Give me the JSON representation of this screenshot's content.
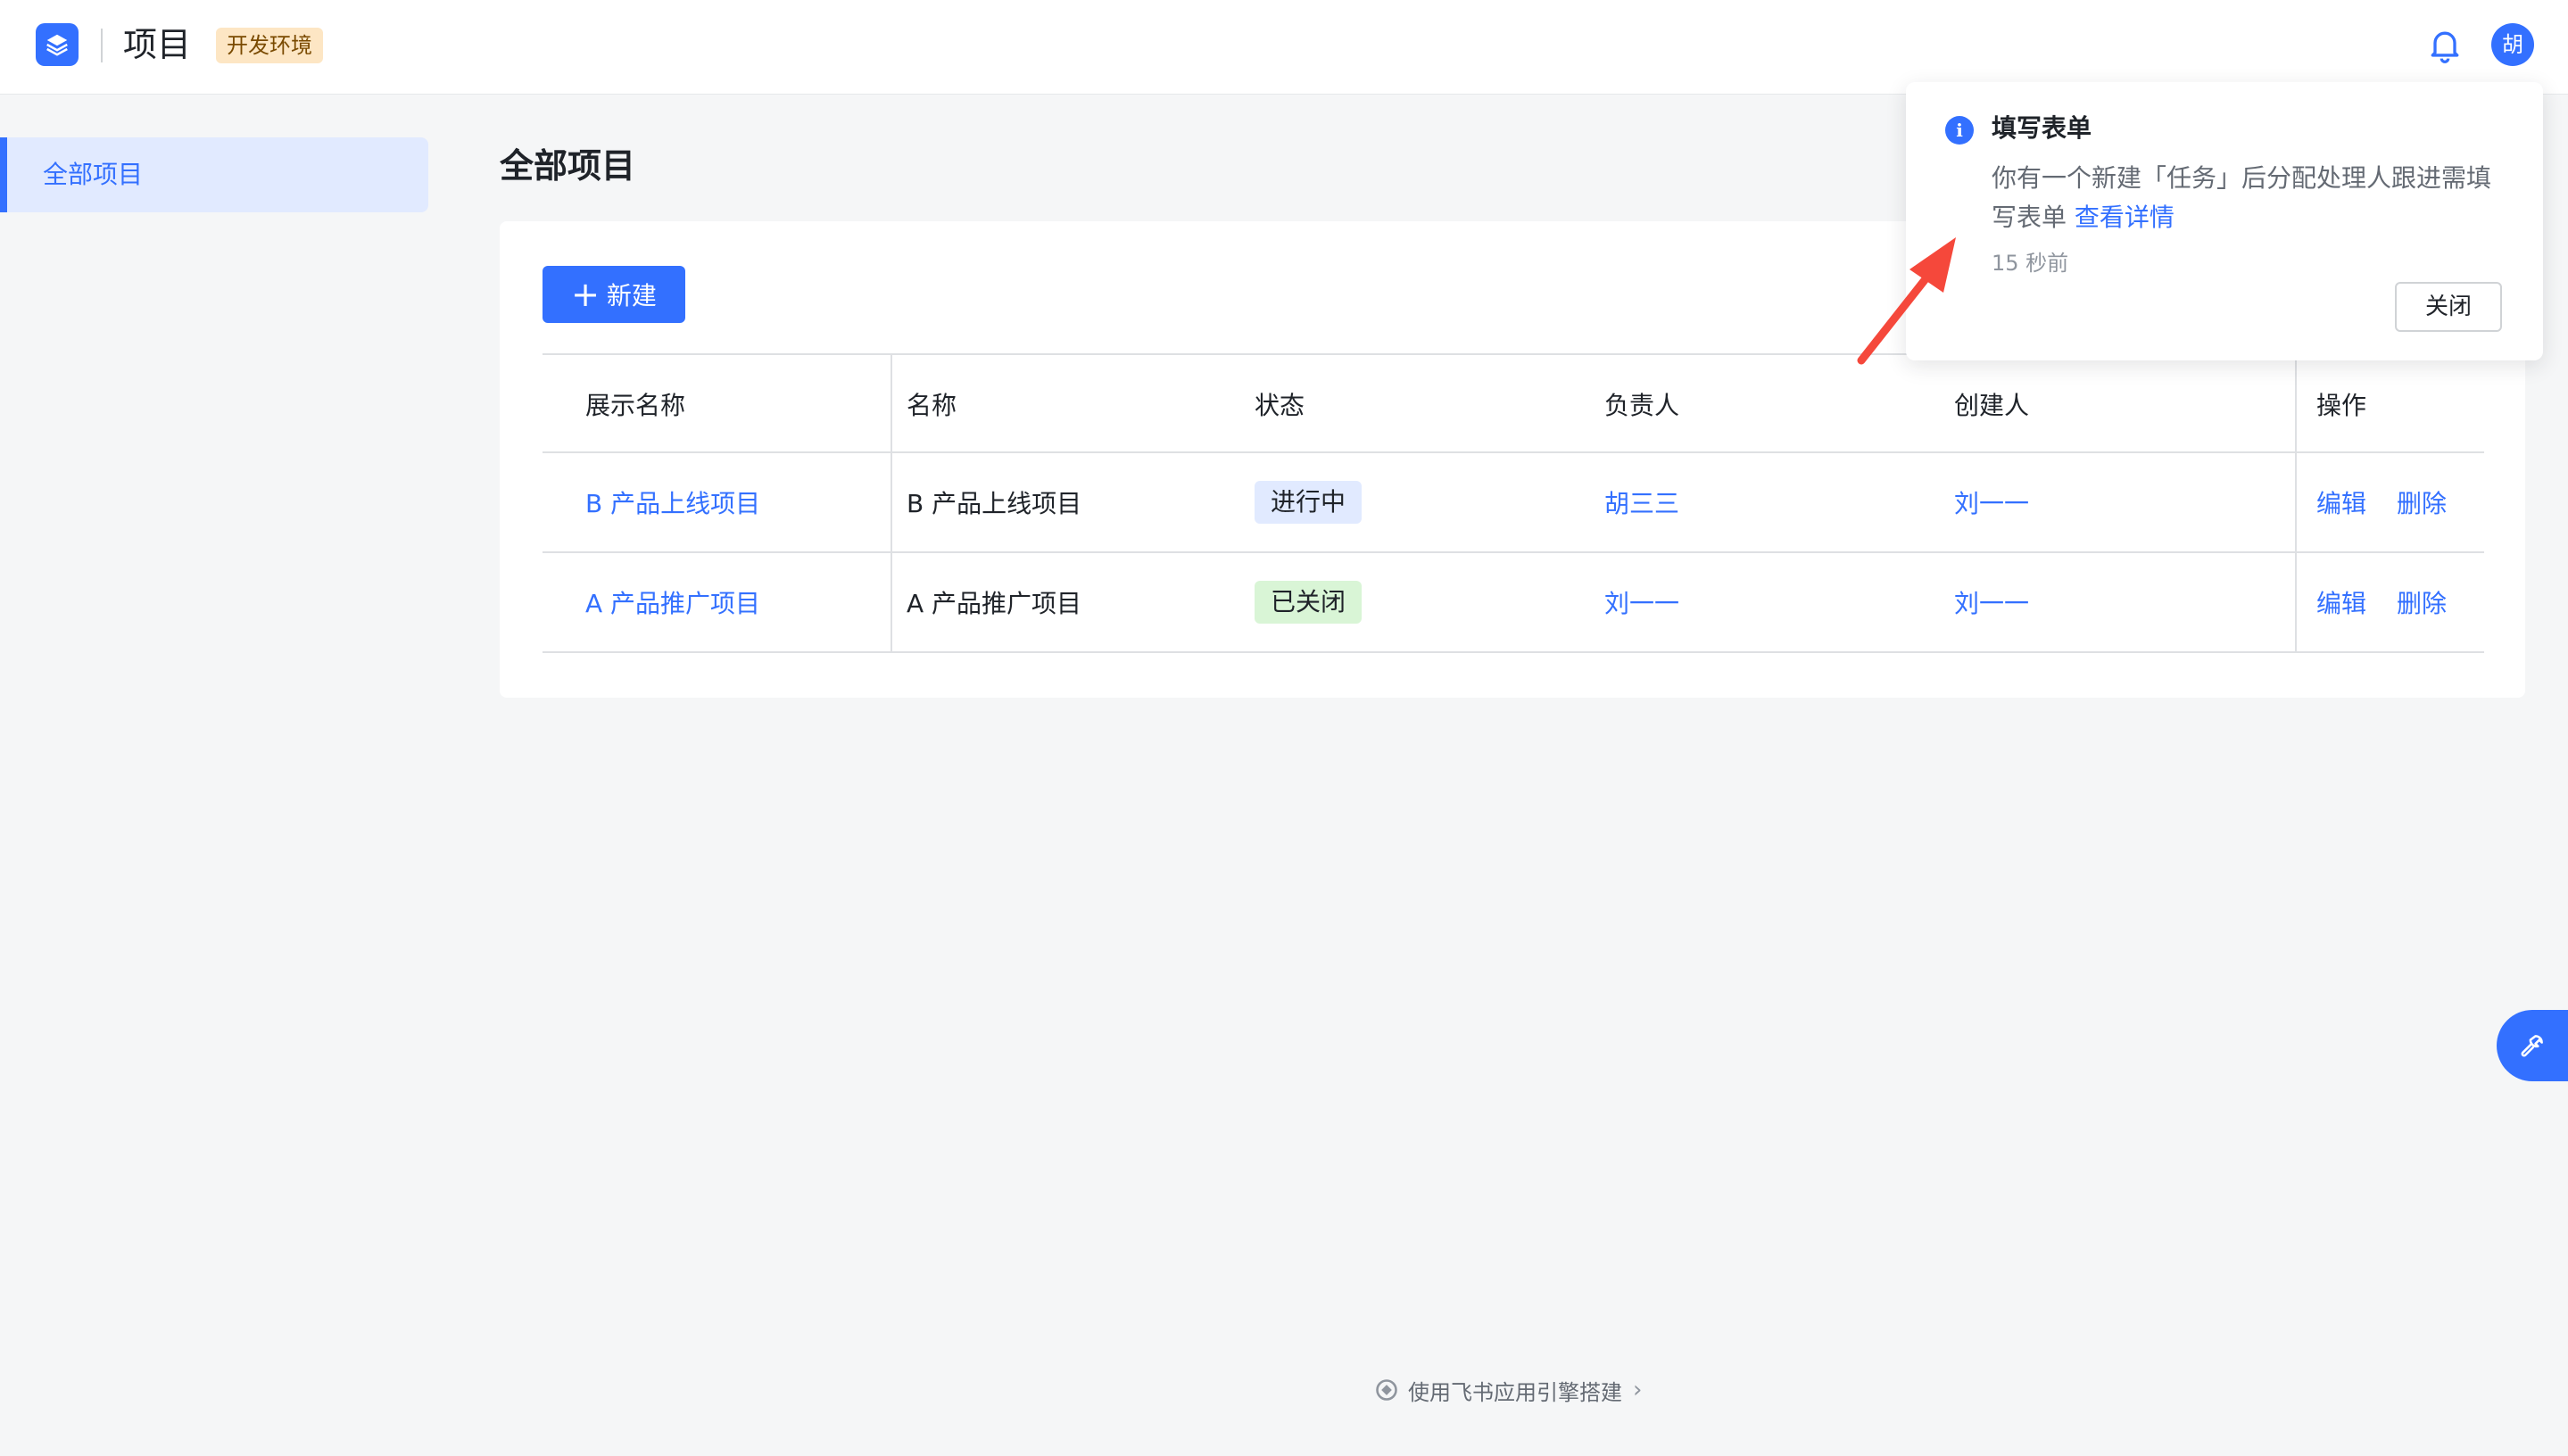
{
  "header": {
    "title": "项目",
    "env_badge": "开发环境",
    "avatar_text": "胡"
  },
  "sidebar": {
    "items": [
      {
        "label": "全部项目",
        "active": true
      }
    ]
  },
  "main": {
    "page_title": "全部项目",
    "new_button_label": "新建",
    "table": {
      "columns": [
        "展示名称",
        "名称",
        "状态",
        "负责人",
        "创建人",
        "操作"
      ],
      "rows": [
        {
          "display_name": "B 产品上线项目",
          "name": "B 产品上线项目",
          "status": "进行中",
          "owner": "胡三三",
          "creator": "刘一一",
          "actions": [
            "编辑",
            "删除"
          ]
        },
        {
          "display_name": "A 产品推广项目",
          "name": "A 产品推广项目",
          "status": "已关闭",
          "owner": "刘一一",
          "creator": "刘一一",
          "actions": [
            "编辑",
            "删除"
          ]
        }
      ]
    }
  },
  "notification": {
    "title": "填写表单",
    "body": "你有一个新建「任务」后分配处理人跟进需填写表单",
    "link_text": "查看详情",
    "time": "15 秒前",
    "close_label": "关闭"
  },
  "footer": {
    "text": "使用飞书应用引擎搭建"
  },
  "icons": {
    "logo": "layers-icon",
    "bell": "bell-icon",
    "info": "info-icon",
    "float": "tool-icon",
    "footer_logo": "feishu-logo-icon",
    "chevron": "chevron-right-icon"
  },
  "colors": {
    "primary": "#3370ff",
    "env_badge_bg": "#fde6c4",
    "status_running_bg": "#e1eaff",
    "status_closed_bg": "#d9f5d6",
    "annotation_arrow": "#f5483b"
  }
}
